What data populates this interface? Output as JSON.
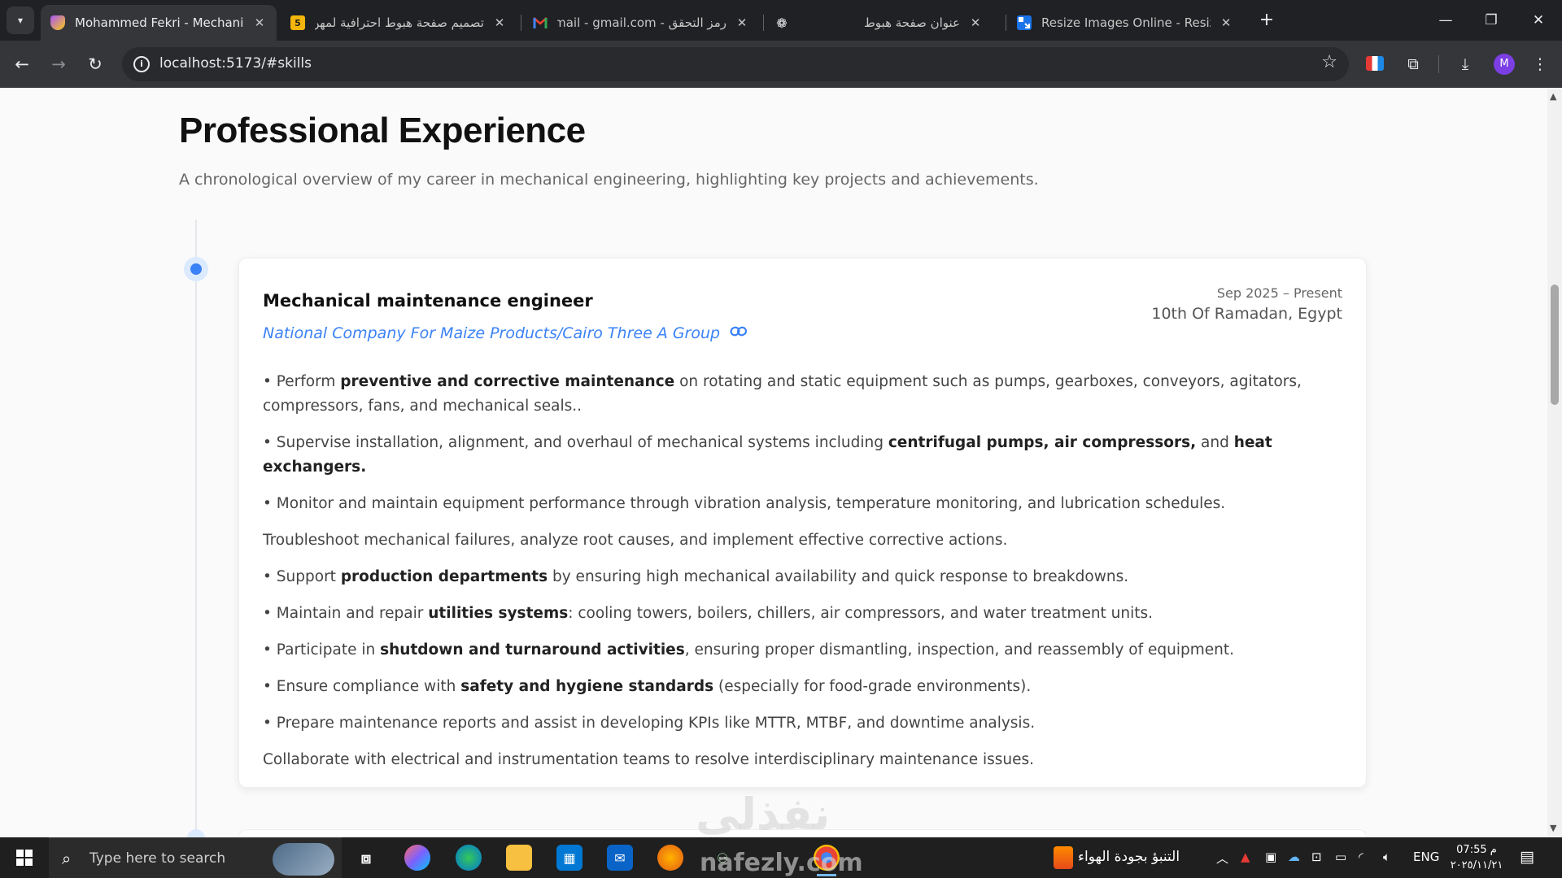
{
  "browser": {
    "tabs": [
      {
        "title": "Mohammed Fekri - Mechanical",
        "rtl": false
      },
      {
        "title": "تصميم صفحة هبوط احترافية لمهن",
        "rtl": true
      },
      {
        "title": "رمز التحقق - Gmail - gmail.com",
        "rtl": true
      },
      {
        "title": "",
        "rtl": false
      },
      {
        "title": "عنوان صفحة هبوط",
        "rtl": true
      },
      {
        "title": "Resize Images Online - Resize JPG",
        "rtl": false
      }
    ],
    "favicon_text_5": "5",
    "url": "localhost:5173/#skills",
    "avatar_letter": "M"
  },
  "section": {
    "title": "Professional Experience",
    "subtitle": "A chronological overview of my career in mechanical engineering, highlighting key projects and achievements."
  },
  "job": {
    "title": "Mechanical maintenance engineer",
    "company": "National Company For Maize Products/Cairo Three A Group",
    "date": "Sep 2025 – Present",
    "location": "10th Of Ramadan, Egypt",
    "bullets": [
      {
        "pre": "• Perform ",
        "bold": "preventive and corrective maintenance",
        "post": " on rotating and static equipment such as pumps, gearboxes, conveyors, agitators, compressors, fans, and mechanical seals.."
      },
      {
        "pre": "• Supervise installation, alignment, and overhaul of mechanical systems including ",
        "bold": "centrifugal pumps, air compressors,",
        "post": " and ",
        "bold2": "heat exchangers."
      },
      {
        "pre": "• Monitor and maintain equipment performance through vibration analysis, temperature monitoring, and lubrication schedules.",
        "bold": "",
        "post": ""
      },
      {
        "pre": "Troubleshoot mechanical failures, analyze root causes, and implement effective corrective actions.",
        "bold": "",
        "post": ""
      },
      {
        "pre": "• Support ",
        "bold": "production departments",
        "post": " by ensuring high mechanical availability and quick response to breakdowns."
      },
      {
        "pre": "• Maintain and repair ",
        "bold": "utilities systems",
        "post": ": cooling towers, boilers, chillers, air compressors, and water treatment units."
      },
      {
        "pre": "• Participate in ",
        "bold": "shutdown and turnaround activities",
        "post": ", ensuring proper dismantling, inspection, and reassembly of equipment."
      },
      {
        "pre": "• Ensure compliance with ",
        "bold": "safety and hygiene standards",
        "post": " (especially for food-grade environments)."
      },
      {
        "pre": "• Prepare maintenance reports and assist in developing KPIs like MTTR, MTBF, and downtime analysis.",
        "bold": "",
        "post": ""
      },
      {
        "pre": "Collaborate with electrical and instrumentation teams to resolve interdisciplinary maintenance issues.",
        "bold": "",
        "post": ""
      }
    ]
  },
  "watermark": "نفذلي",
  "taskbar": {
    "search_placeholder": "Type here to search",
    "weather_text": "التنبؤ بجودة الهواء",
    "language": "ENG",
    "time": "07:55 م",
    "date": "٢٠٢٥/١١/٢١",
    "nafezly_text": "nafezly.com"
  },
  "colors": {
    "accent": "#3b82f6",
    "chrome_dark": "#202124",
    "chrome_toolbar": "#35363a"
  }
}
